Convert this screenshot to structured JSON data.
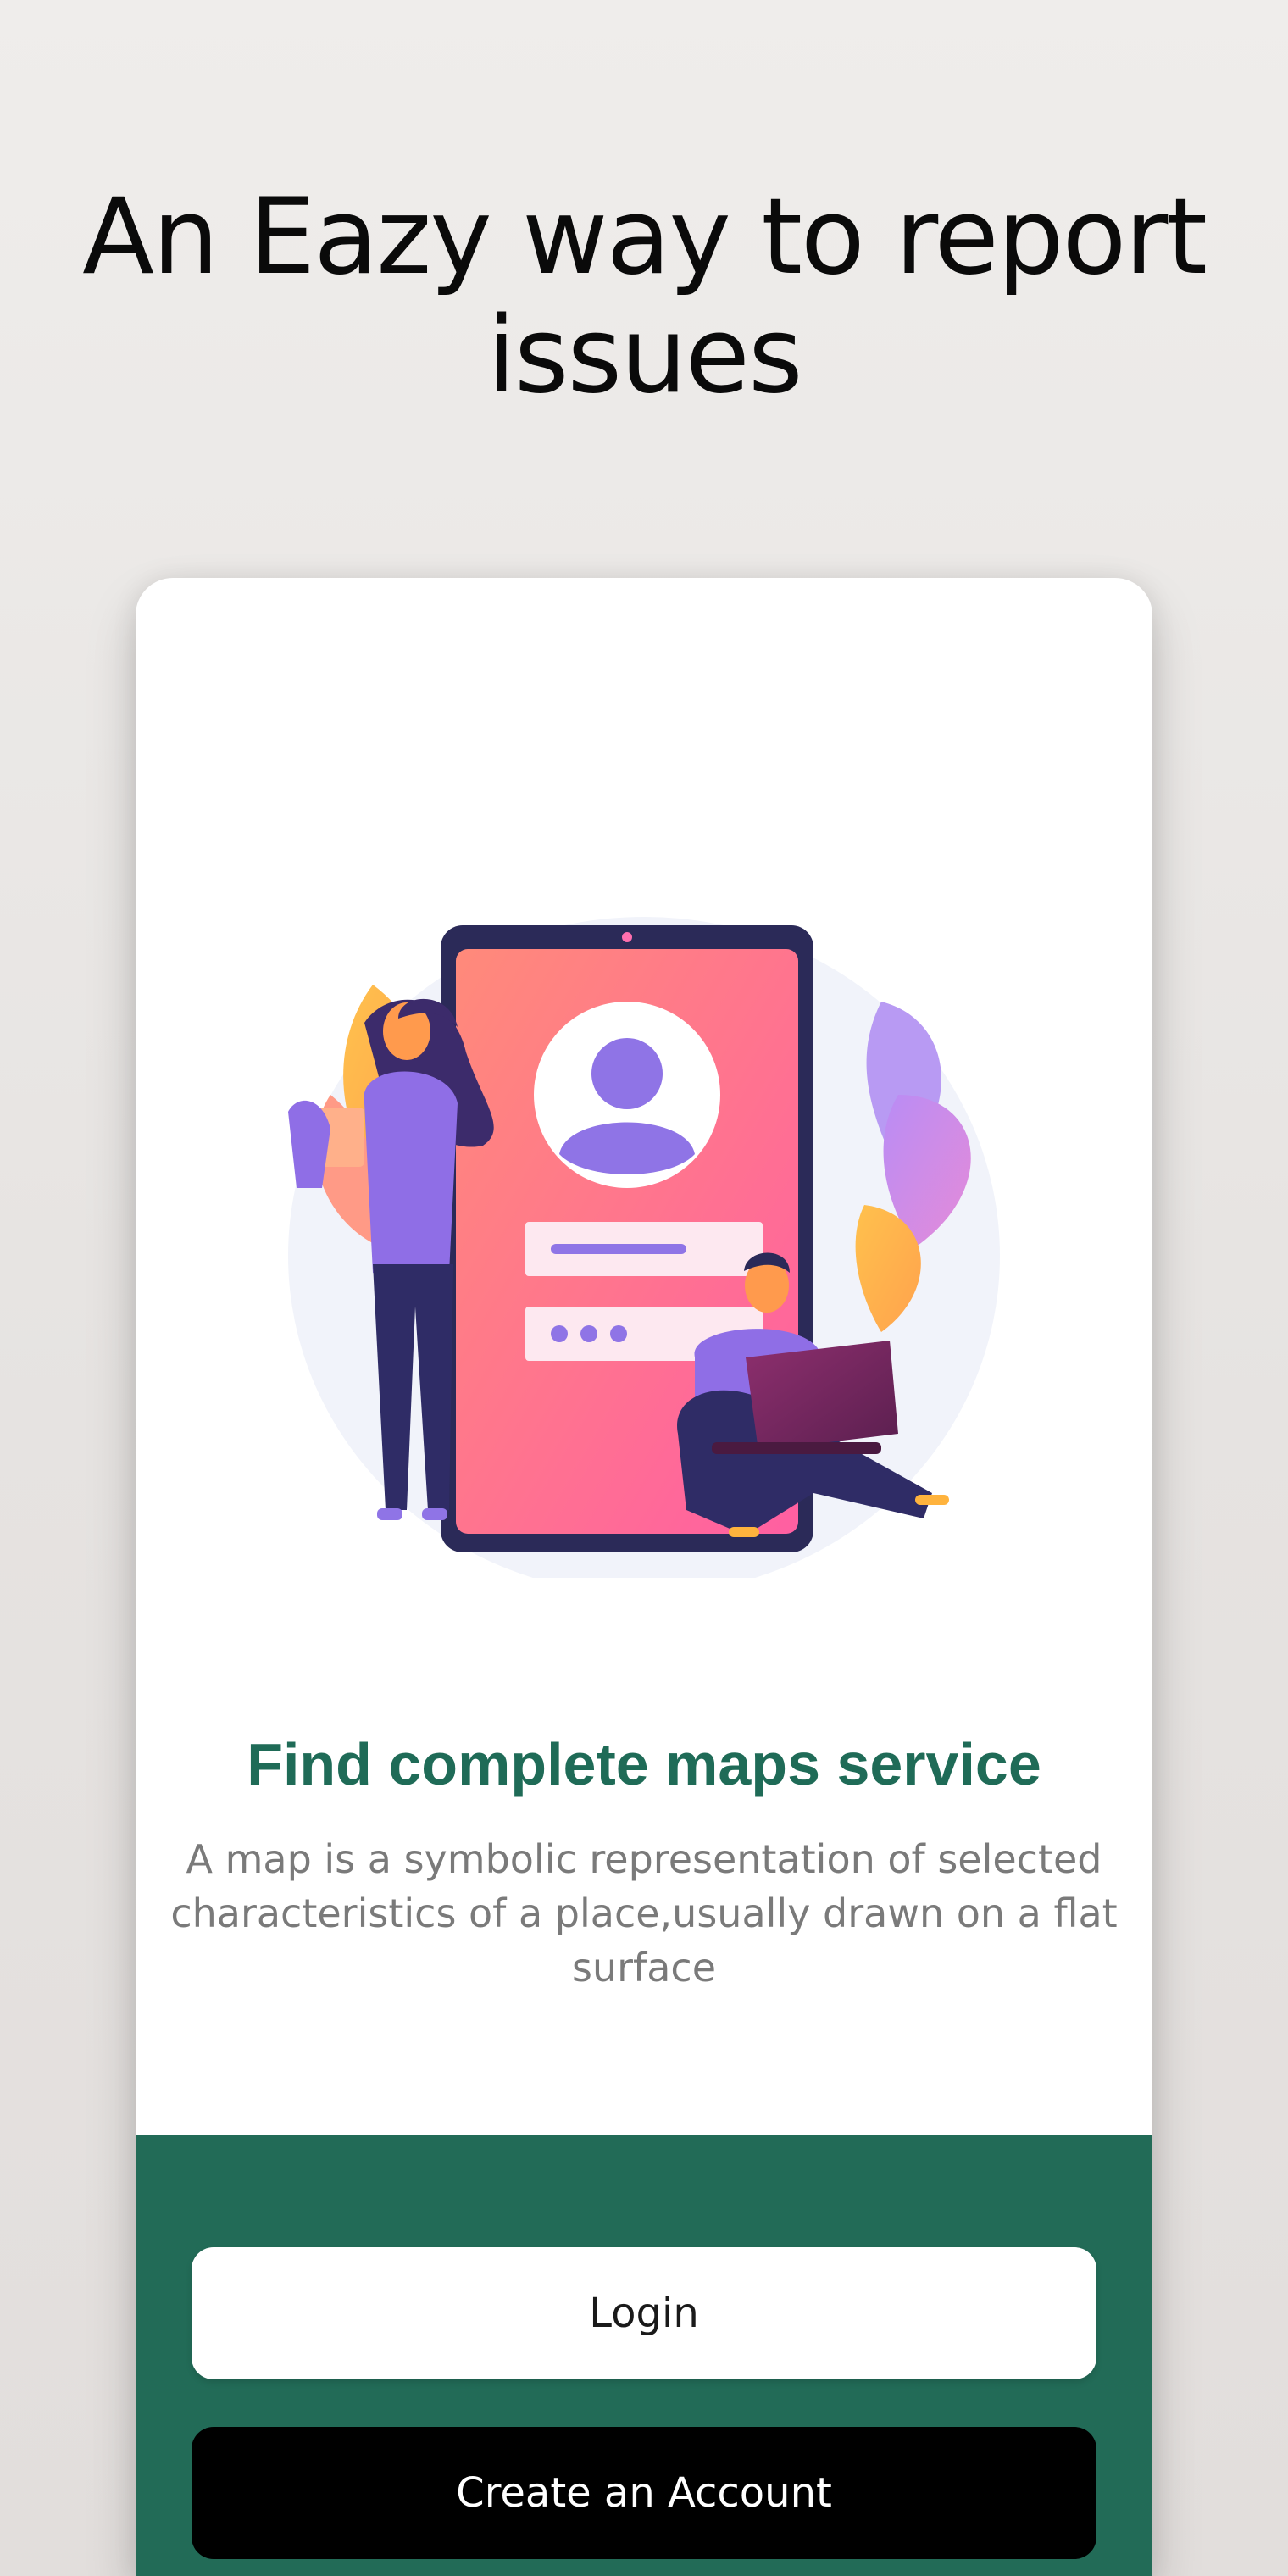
{
  "headline": {
    "line1": "An Eazy way to report",
    "line2": "issues"
  },
  "feature": {
    "title": "Find complete maps service",
    "description_line1": "A map is a symbolic representation of selected",
    "description_line2": "characteristics of a place,usually drawn on a flat",
    "description_line3": "surface"
  },
  "actions": {
    "login_label": "Login",
    "create_label": "Create an Account"
  },
  "colors": {
    "brand_green": "#226b57",
    "title_green": "#1f6b57"
  },
  "illustration": {
    "icon": "user-profile-login-illustration"
  }
}
